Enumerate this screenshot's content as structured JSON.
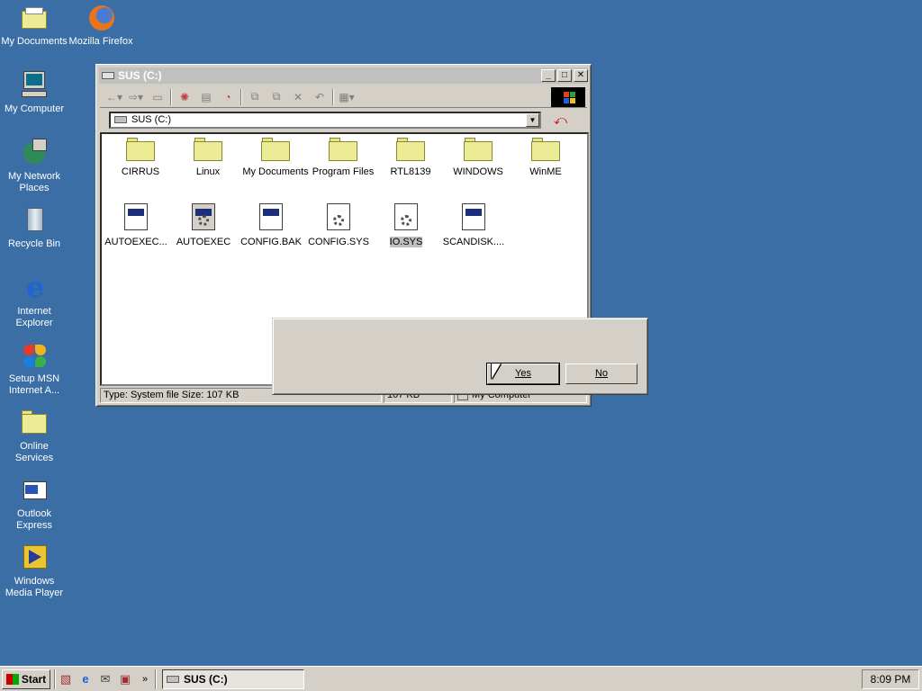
{
  "desktop": {
    "icons": [
      {
        "label": "My Documents"
      },
      {
        "label": "Mozilla Firefox"
      },
      {
        "label": "My Computer"
      },
      {
        "label": "My Network Places"
      },
      {
        "label": "Recycle Bin"
      },
      {
        "label": "Internet Explorer"
      },
      {
        "label": "Setup MSN Internet A..."
      },
      {
        "label": "Online Services"
      },
      {
        "label": "Outlook Express"
      },
      {
        "label": "Windows Media Player"
      }
    ]
  },
  "window": {
    "title": "SUS (C:)",
    "address": "SUS (C:)",
    "items": [
      {
        "label": "CIRRUS"
      },
      {
        "label": "Linux"
      },
      {
        "label": "My Documents"
      },
      {
        "label": "Program Files"
      },
      {
        "label": "RTL8139"
      },
      {
        "label": "WINDOWS"
      },
      {
        "label": "WinME"
      },
      {
        "label": "AUTOEXEC..."
      },
      {
        "label": "AUTOEXEC"
      },
      {
        "label": "CONFIG.BAK"
      },
      {
        "label": "CONFIG.SYS"
      },
      {
        "label": "IO.SYS"
      },
      {
        "label": "SCANDISK...."
      }
    ],
    "status": {
      "type_text": "Type: System file Size: 107 KB",
      "size": "107 KB",
      "location": "My Computer"
    }
  },
  "dialog": {
    "yes_label": "Yes",
    "no_label": "No"
  },
  "taskbar": {
    "start_label": "Start",
    "task_label": "SUS (C:)",
    "clock": "8:09 PM"
  },
  "colors": {
    "desktop": "#3a6ea5",
    "titlebar_inactive": "#c0c0c0",
    "face": "#d4d0c8"
  }
}
